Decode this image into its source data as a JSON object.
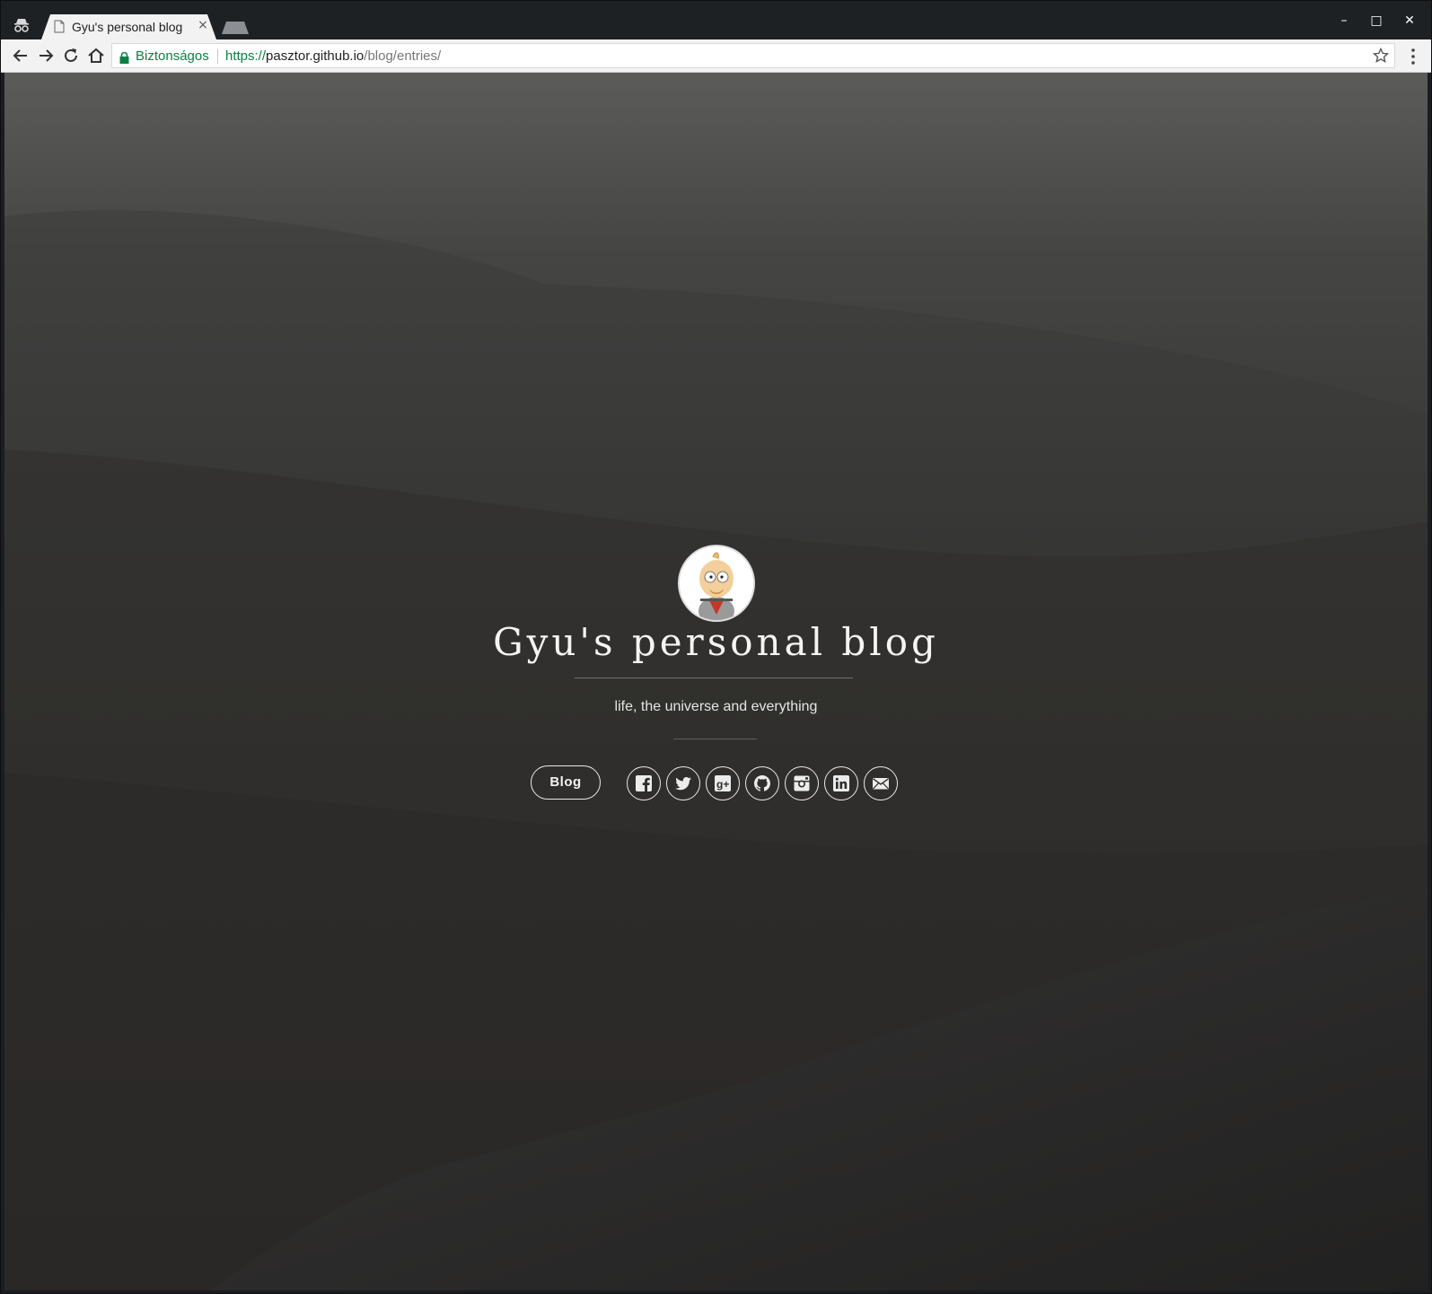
{
  "browser": {
    "tab_title": "Gyu's personal blog",
    "tab_close": "×",
    "window_controls": {
      "minimize": "–",
      "maximize": "□",
      "close": "✕"
    },
    "security_label": "Biztonságos",
    "url": {
      "scheme": "https://",
      "host": "pasztor.github.io",
      "path": "/blog/entries/"
    },
    "icons": [
      "incognito-icon",
      "page-icon",
      "back-icon",
      "forward-icon",
      "reload-icon",
      "home-icon",
      "lock-icon",
      "star-icon",
      "menu-icon"
    ]
  },
  "page": {
    "title": "Gyu's personal blog",
    "tagline": "life, the universe and everything",
    "blog_button": "Blog",
    "social_links": [
      {
        "name": "facebook",
        "icon": "facebook-icon"
      },
      {
        "name": "twitter",
        "icon": "twitter-icon"
      },
      {
        "name": "google-plus",
        "icon": "google-plus-icon"
      },
      {
        "name": "github",
        "icon": "github-icon"
      },
      {
        "name": "instagram",
        "icon": "instagram-icon"
      },
      {
        "name": "linkedin",
        "icon": "linkedin-icon"
      },
      {
        "name": "email",
        "icon": "email-icon"
      }
    ]
  },
  "colors": {
    "secure_green": "#0b8043",
    "hero_text": "#f4f4f4",
    "tab_bg": "#f2f2f2",
    "frame_bg": "#1e2124"
  }
}
